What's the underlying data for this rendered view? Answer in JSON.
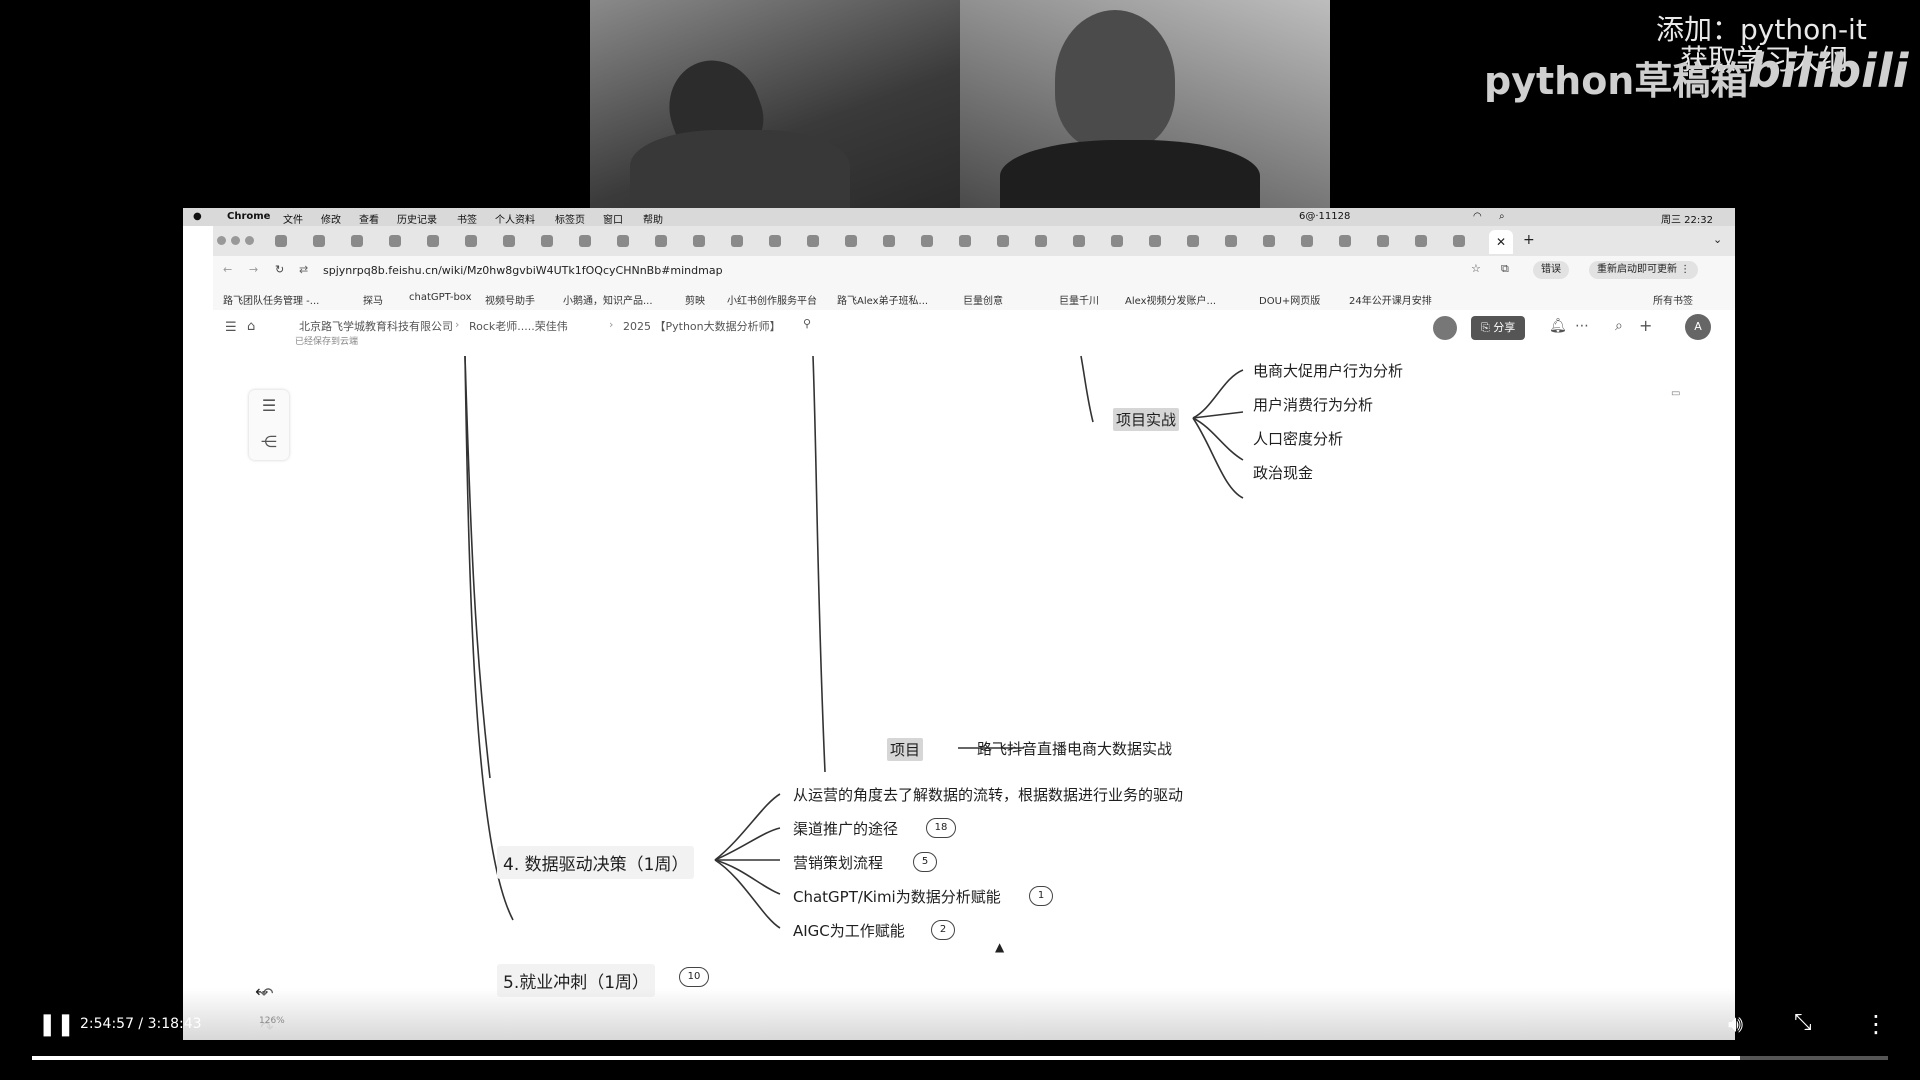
{
  "watermark": {
    "line1": "添加：python-it",
    "line2": "获取学习大纲",
    "channel": "python草稿箱",
    "logo": "bilibili"
  },
  "menubar": {
    "app": "Chrome",
    "items": [
      "文件",
      "修改",
      "查看",
      "历史记录",
      "书签",
      "个人资料",
      "标签页",
      "窗口",
      "帮助"
    ],
    "status": "6@·11128",
    "clock": "周三 22:32"
  },
  "browser": {
    "url": "spjynrpq8b.feishu.cn/wiki/Mz0hw8gvbiW4UTk1fOQcyCHNnBb#mindmap",
    "error_label": "错误",
    "update_label": "重新启动即可更新",
    "bookmarks": [
      "路飞团队任务管理 -...",
      "探马",
      "chatGPT-box",
      "视频号助手",
      "小鹅通，知识产品...",
      "剪映",
      "小红书创作服务平台",
      "路飞Alex弟子班私...",
      "巨量创意",
      "巨量千川",
      "Alex视频分发账户...",
      "DOU+网页版",
      "24年公开课月安排"
    ],
    "all_bookmarks": "所有书签"
  },
  "doc": {
    "breadcrumb": [
      "北京路飞学城教育科技有限公司",
      "Rock老师.....荣佳伟",
      "2025 【Python大数据分析师】"
    ],
    "saved": "已经保存到云端",
    "share_label": "分享",
    "avatar_letter": "A"
  },
  "mindmap": {
    "project_practice": "项目实战",
    "practice_items": [
      "电商大促用户行为分析",
      "用户消费行为分析",
      "人口密度分析",
      "政治现金"
    ],
    "project": "项目",
    "project_desc": "路飞抖音直播电商大数据实战",
    "section4": "4. 数据驱动决策（1周）",
    "section4_items": [
      {
        "label": "从运营的角度去了解数据的流转，根据数据进行业务的驱动",
        "badge": ""
      },
      {
        "label": "渠道推广的途径",
        "badge": "18"
      },
      {
        "label": "营销策划流程",
        "badge": "5"
      },
      {
        "label": "ChatGPT/Kimi为数据分析赋能",
        "badge": "1"
      },
      {
        "label": "AIGC为工作赋能",
        "badge": "2"
      }
    ],
    "section5": "5.就业冲刺（1周）",
    "section5_badge": "10",
    "zoom": "126%"
  },
  "player": {
    "time": "2:54:57 / 3:18:43",
    "progress": 0.9205
  }
}
